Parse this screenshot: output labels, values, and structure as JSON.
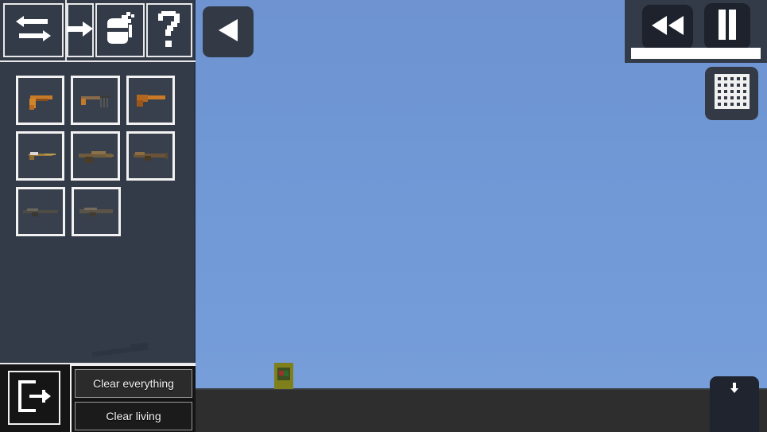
{
  "app": {
    "title": "Weapon Sandbox",
    "colors": {
      "sky": "#6f97d4",
      "ground": "#2e2e2e",
      "sidebar": "#333b48",
      "panel_border": "#e8e8e8",
      "button_dark": "#1d222c",
      "text": "#f2f2f2"
    }
  },
  "toolbar": {
    "items": [
      {
        "id": "swap",
        "icon": "swap-arrows-icon",
        "label": "Swap"
      },
      {
        "id": "next",
        "icon": "arrow-right-icon",
        "label": "Next"
      },
      {
        "id": "spray",
        "icon": "spray-can-icon",
        "label": "Spray"
      },
      {
        "id": "help",
        "icon": "question-mark-icon",
        "label": "?"
      }
    ]
  },
  "weapon_grid": {
    "rows": [
      [
        {
          "id": "slot-1",
          "name": "pistol",
          "selected": false
        },
        {
          "id": "slot-2",
          "name": "machine-pistol",
          "selected": false
        },
        {
          "id": "slot-3",
          "name": "sawed-off-shotgun",
          "selected": false
        }
      ],
      [
        {
          "id": "slot-4",
          "name": "smg",
          "selected": false
        },
        {
          "id": "slot-5",
          "name": "assault-rifle",
          "selected": false
        },
        {
          "id": "slot-6",
          "name": "carbine-rifle",
          "selected": false
        }
      ],
      [
        {
          "id": "slot-7",
          "name": "sniper-rifle",
          "selected": false
        },
        {
          "id": "slot-8",
          "name": "battle-rifle",
          "selected": false
        }
      ]
    ]
  },
  "loose_weapon": {
    "name": "dropped-rifle"
  },
  "bottom_bar": {
    "exit": {
      "icon": "exit-door-icon",
      "label": "Exit"
    },
    "clear_everything_label": "Clear everything",
    "clear_living_label": "Clear living"
  },
  "overlay": {
    "back_button": {
      "icon": "triangle-left-icon",
      "label": "Back"
    },
    "rewind_button": {
      "icon": "rewind-icon",
      "label": "Rewind"
    },
    "pause_button": {
      "icon": "pause-icon",
      "label": "Pause"
    },
    "seek_bar": {
      "value": 100,
      "label": "Timeline"
    },
    "grid_button": {
      "icon": "grid-icon",
      "label": "Grid"
    },
    "download_button": {
      "icon": "download-arrow-icon",
      "label": "Download"
    }
  },
  "scene": {
    "player": {
      "name": "player-character"
    }
  }
}
